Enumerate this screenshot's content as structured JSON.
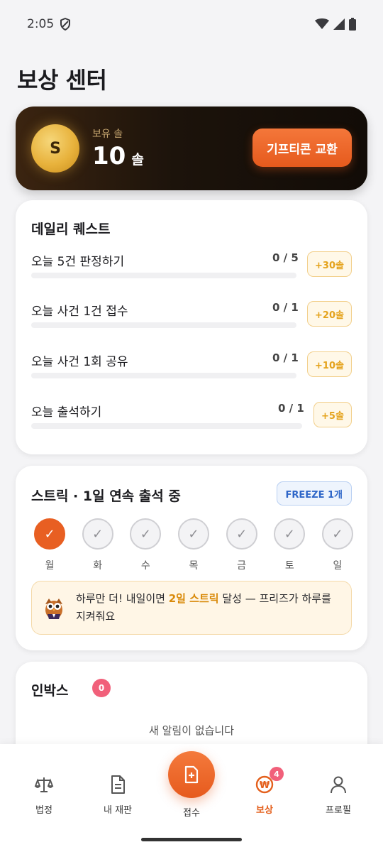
{
  "status_bar": {
    "time": "2:05"
  },
  "page": {
    "title": "보상 센터"
  },
  "balance": {
    "label": "보유 솔",
    "coin_letter": "S",
    "value": "10",
    "unit": "솔",
    "exchange_label": "기프티콘 교환"
  },
  "quests": {
    "title": "데일리 퀘스트",
    "items": [
      {
        "name": "오늘 5건 판정하기",
        "progress": "0 / 5",
        "reward": "+30솔",
        "fraction": 0
      },
      {
        "name": "오늘 사건 1건 접수",
        "progress": "0 / 1",
        "reward": "+20솔",
        "fraction": 0
      },
      {
        "name": "오늘 사건 1회 공유",
        "progress": "0 / 1",
        "reward": "+10솔",
        "fraction": 0
      },
      {
        "name": "오늘 출석하기",
        "progress": "0 / 1",
        "reward": "+5솔",
        "fraction": 0
      }
    ]
  },
  "streak": {
    "title": "스트릭 · 1일 연속 출석 중",
    "freeze": "FREEZE 1개",
    "days": [
      {
        "label": "월",
        "done": true
      },
      {
        "label": "화",
        "done": false
      },
      {
        "label": "수",
        "done": false
      },
      {
        "label": "목",
        "done": false
      },
      {
        "label": "금",
        "done": false
      },
      {
        "label": "토",
        "done": false
      },
      {
        "label": "일",
        "done": false
      }
    ],
    "message_pre": "하루만 더! 내일이면 ",
    "message_highlight": "2일 스트릭",
    "message_post": " 달성 — 프리즈가 하루를 지켜줘요"
  },
  "inbox": {
    "title": "인박스",
    "count": "0",
    "empty": "새 알림이 없습니다"
  },
  "nav": {
    "court": "법정",
    "my_trials": "내 재판",
    "submit": "접수",
    "rewards": "보상",
    "rewards_badge": "4",
    "profile": "프로필"
  },
  "colors": {
    "accent": "#e65a1d",
    "gold": "#e4a21b",
    "badge": "#f1607a"
  }
}
